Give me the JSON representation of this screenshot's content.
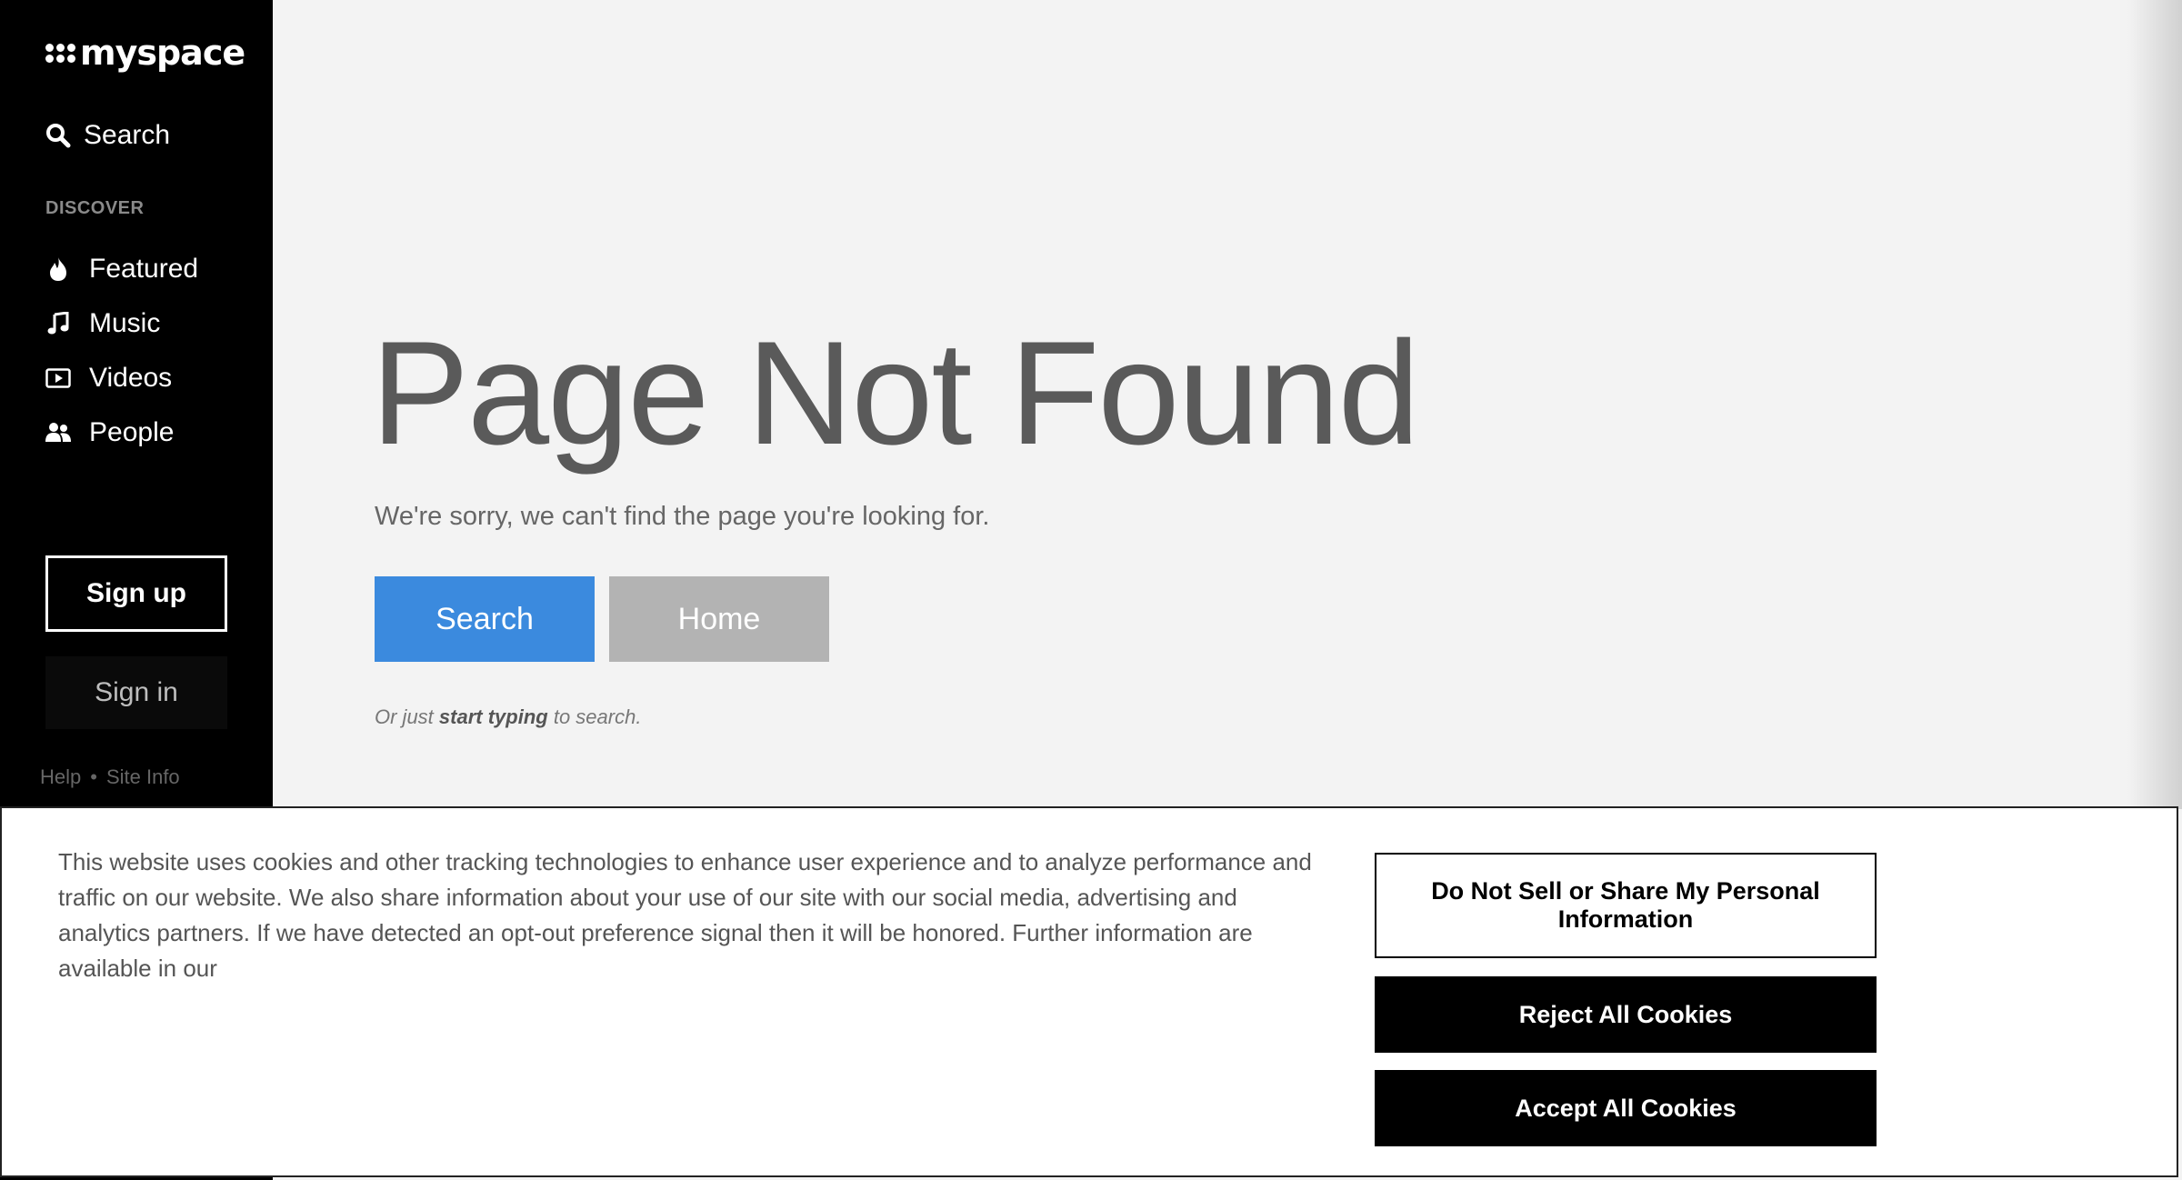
{
  "sidebar": {
    "logo": "myspace",
    "search_label": "Search",
    "section_label": "DISCOVER",
    "items": [
      {
        "label": "Featured",
        "icon": "flame-icon"
      },
      {
        "label": "Music",
        "icon": "music-note-icon"
      },
      {
        "label": "Videos",
        "icon": "video-play-icon"
      },
      {
        "label": "People",
        "icon": "people-icon"
      }
    ],
    "signup_label": "Sign up",
    "signin_label": "Sign in",
    "footer": {
      "help": "Help",
      "separator": "•",
      "site_info": "Site Info"
    }
  },
  "main": {
    "title": "Page Not Found",
    "subtitle": "We're sorry, we can't find the page you're looking for.",
    "search_button": "Search",
    "home_button": "Home",
    "hint_prefix": "Or just",
    "hint_bold": "start typing",
    "hint_suffix": "to search."
  },
  "cookie": {
    "text": "This website uses cookies and other tracking technologies to enhance user experience and to analyze performance and traffic on our website. We also share information about your use of our site with our social media, advertising and analytics partners. If we have detected an opt-out preference signal then it will be honored. Further information are available in our",
    "do_not_sell": "Do Not Sell or Share My Personal Information",
    "reject": "Reject All Cookies",
    "accept": "Accept All Cookies"
  },
  "colors": {
    "sidebar_bg": "#000000",
    "page_bg": "#f3f3f3",
    "search_button": "#3b8ade",
    "home_button": "#b3b3b3"
  }
}
